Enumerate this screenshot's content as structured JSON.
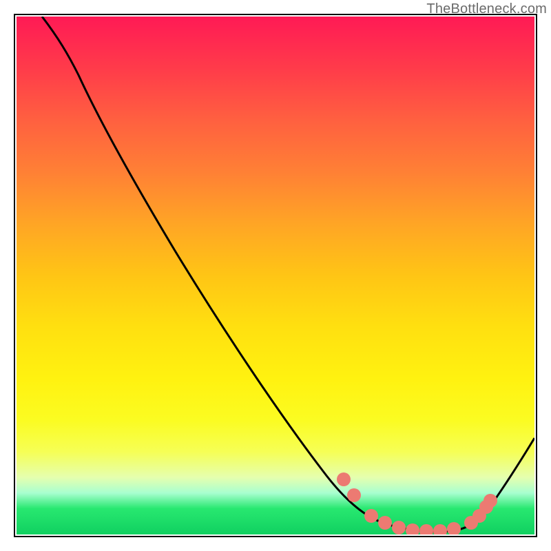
{
  "watermark": "TheBottleneck.com",
  "chart_data": {
    "type": "line",
    "title": "",
    "xlabel": "",
    "ylabel": "",
    "xlim": [
      0,
      100
    ],
    "ylim": [
      0,
      100
    ],
    "series": [
      {
        "name": "curve",
        "x": [
          5,
          10,
          15,
          20,
          25,
          30,
          35,
          40,
          45,
          50,
          55,
          60,
          65,
          70,
          72,
          75,
          78,
          80,
          83,
          86,
          90,
          95,
          100
        ],
        "y": [
          100,
          94,
          86,
          77,
          69,
          61,
          53,
          45,
          37,
          30,
          23,
          17,
          11,
          6,
          4,
          2,
          1,
          1,
          1,
          1,
          3,
          10,
          18
        ]
      }
    ],
    "markers": {
      "name": "dots",
      "x": [
        62,
        65,
        70,
        73,
        76,
        79,
        82,
        85,
        87,
        89,
        90
      ],
      "y": [
        12,
        8,
        3,
        2,
        1.5,
        1.2,
        1.2,
        1.5,
        2.5,
        4,
        5
      ]
    },
    "background_gradient": {
      "top": "#ff1a55",
      "mid": "#ffe010",
      "bottom": "#10d060"
    }
  }
}
